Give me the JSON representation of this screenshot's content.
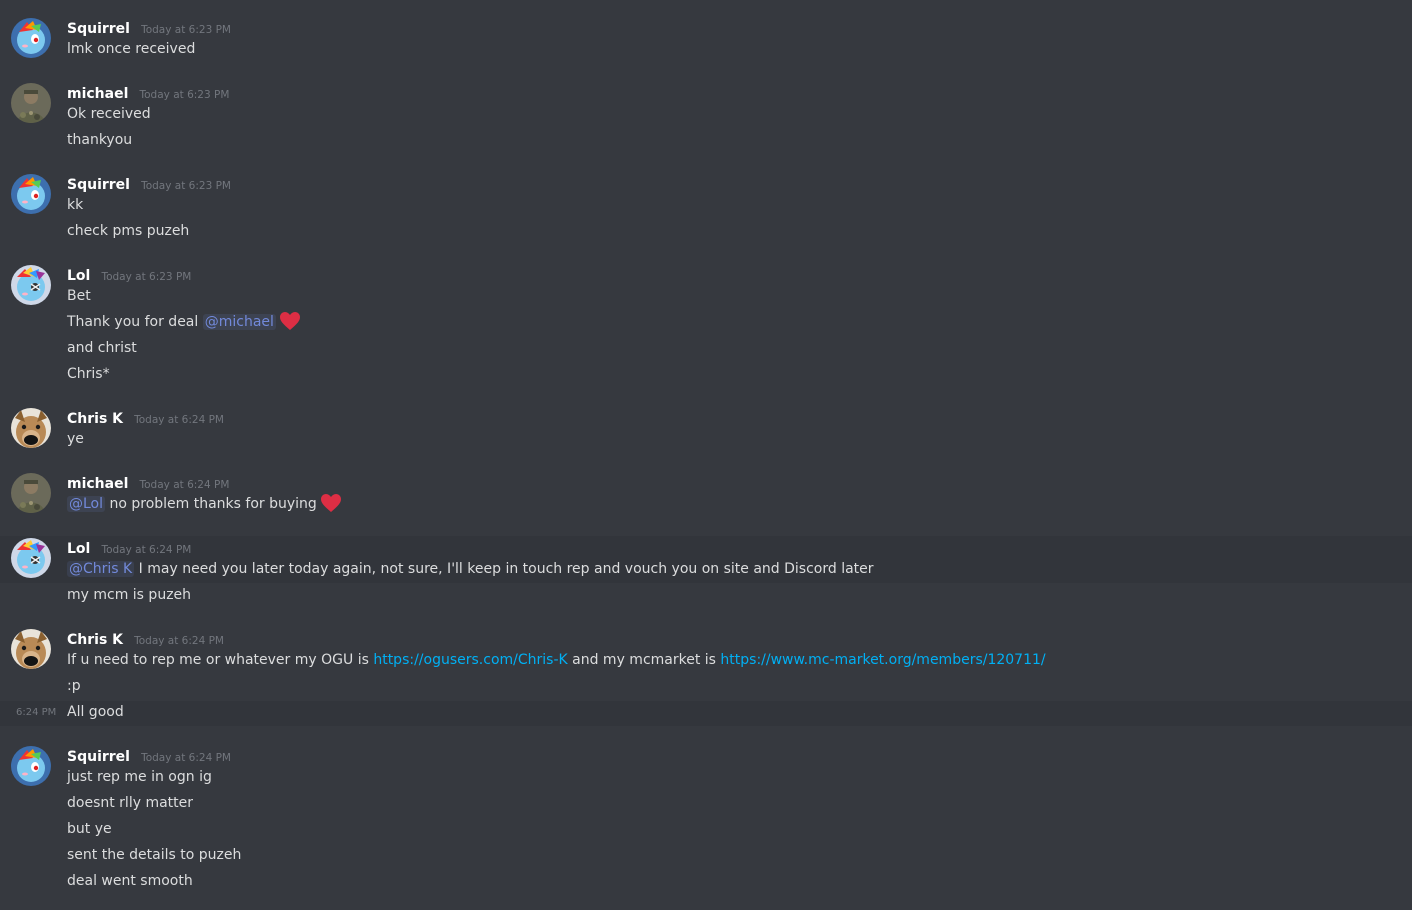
{
  "messages": [
    {
      "author": "Squirrel",
      "time": "Today at 6:23 PM",
      "lines": [
        "lmk once received"
      ]
    },
    {
      "author": "michael",
      "time": "Today at 6:23 PM",
      "lines": [
        "Ok received",
        "thankyou"
      ]
    },
    {
      "author": "Squirrel",
      "time": "Today at 6:23 PM",
      "lines": [
        "kk",
        "check pms puzeh"
      ]
    },
    {
      "author": "Lol",
      "time": "Today at 6:23 PM",
      "lines": {
        "l0": "Bet",
        "l1_text": "Thank you for deal ",
        "l1_mention": "@michael",
        "l2": "and christ",
        "l3": "Chris*"
      }
    },
    {
      "author": "Chris K",
      "time": "Today at 6:24 PM",
      "lines": [
        "ye"
      ]
    },
    {
      "author": "michael",
      "time": "Today at 6:24 PM",
      "lines": {
        "l0_mention": "@Lol",
        "l0_text": " no problem thanks for buying"
      }
    },
    {
      "author": "Lol",
      "time": "Today at 6:24 PM",
      "lines": {
        "l0_mention": "@Chris K",
        "l0_text": " I may need you later today again, not sure, I'll keep in touch rep and vouch you on site and Discord later",
        "l1": "my mcm is puzeh"
      }
    },
    {
      "author": "Chris K",
      "time": "Today at 6:24 PM",
      "lines": {
        "l0_a": "If u need to rep me or whatever my OGU is ",
        "l0_link1": "https://ogusers.com/Chris-K",
        "l0_b": " and my mcmarket is ",
        "l0_link2": "https://www.mc-market.org/members/120711/",
        "l1": ":p",
        "l2": "All good",
        "l2_side_time": "6:24 PM"
      }
    },
    {
      "author": "Squirrel",
      "time": "Today at 6:24 PM",
      "lines": [
        "just rep me in ogn ig",
        "doesnt rlly matter",
        "but ye",
        "sent the details to puzeh",
        "deal went smooth"
      ]
    }
  ],
  "colors": {
    "background": "#36393f",
    "username": "#ffffff",
    "timestamp": "#72767d",
    "text": "#dcddde",
    "mention": "#7289da",
    "link": "#00b0f4",
    "heart": "#dd2e44"
  },
  "icons": {
    "heart": "red-heart-emoji",
    "avatar_squirrel": "pony-avatar",
    "avatar_michael": "camo-soldier-avatar",
    "avatar_lol": "pony-eyepatch-avatar",
    "avatar_chris": "dog-face-avatar"
  }
}
